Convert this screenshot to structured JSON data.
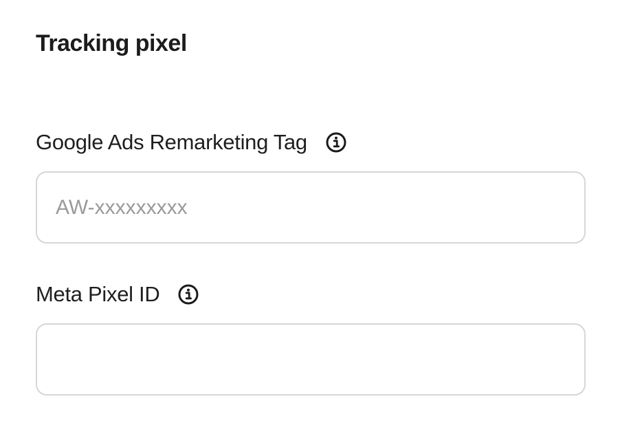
{
  "section": {
    "title": "Tracking pixel"
  },
  "fields": {
    "google_ads": {
      "label": "Google Ads Remarketing Tag",
      "value": "",
      "placeholder": "AW-xxxxxxxxx",
      "info_icon": "info-circle-icon"
    },
    "meta_pixel": {
      "label": "Meta Pixel ID",
      "value": "",
      "placeholder": "",
      "info_icon": "info-circle-icon"
    }
  },
  "colors": {
    "text": "#1f1f1f",
    "placeholder": "#9a9a9a",
    "border": "#d6d6d6",
    "background": "#ffffff"
  }
}
